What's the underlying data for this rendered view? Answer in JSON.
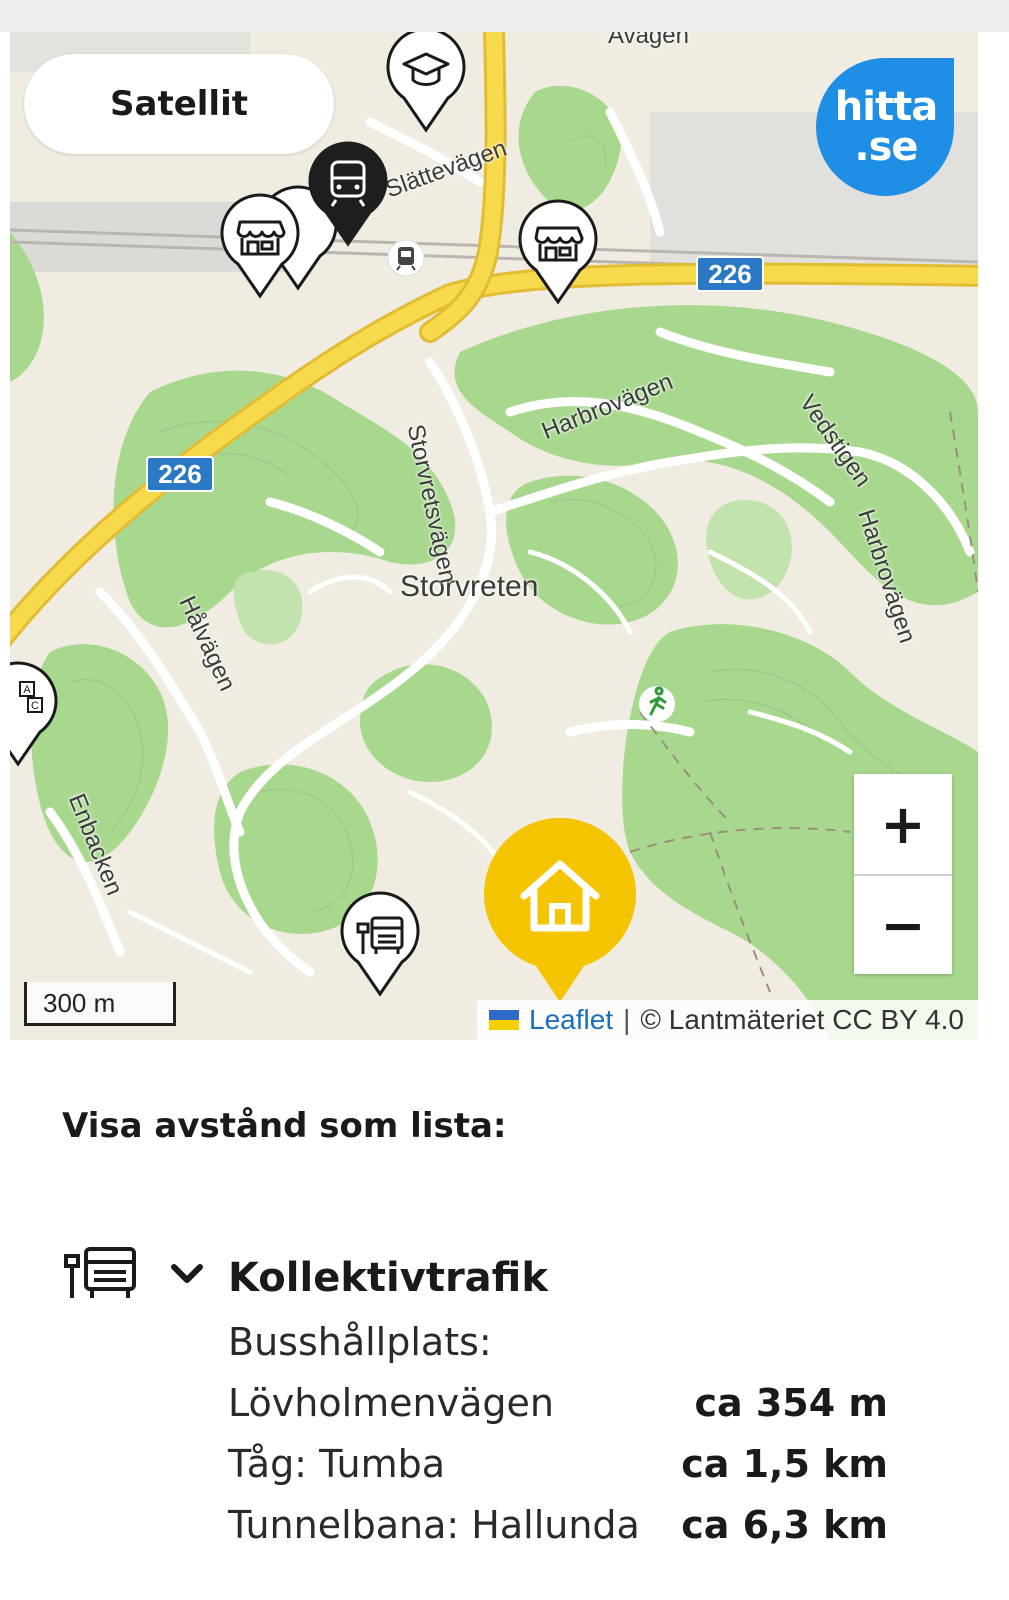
{
  "map": {
    "satellite_label": "Satellit",
    "logo": {
      "line1": "hitta",
      "line2": ".se",
      "color": "#1f8fe6"
    },
    "labels": {
      "district": "Storvreten",
      "road_226_a": "226",
      "road_226_b": "226",
      "storvretsvagen": "Storvretsvägen",
      "harbrovagen_1": "Harbrovägen",
      "harbrovagen_2": "Harbrovägen",
      "vedstigen": "Vedstigen",
      "halvagen": "Hålvägen",
      "enbacken": "Enbacken",
      "slattevagen": "Slättevägen",
      "avagen": "Avägen"
    },
    "zoom": {
      "in": "+",
      "out": "−"
    },
    "scale": "300 m",
    "attribution": {
      "link": "Leaflet",
      "separator": "|",
      "text": "© Lantmäteriet CC BY 4.0"
    },
    "markers": [
      "school-marker",
      "train-station-marker",
      "shop-marker",
      "shop-marker",
      "shop-marker",
      "bus-stop-marker",
      "home-marker",
      "preschool-marker"
    ],
    "colors": {
      "home": "#f5c400",
      "highway": "#f7d94c",
      "green": "#a8d88e",
      "road_shield": "#2b78c5"
    }
  },
  "list": {
    "heading": "Visa avstånd som lista:",
    "category": {
      "title": "Kollektivtrafik",
      "icon": "bus-stop-icon",
      "rows": [
        {
          "label": "Busshållplats:",
          "value": ""
        },
        {
          "label": "Lövholmenvägen",
          "value": "ca 354 m"
        },
        {
          "label": "Tåg: Tumba",
          "value": "ca 1,5 km"
        },
        {
          "label": "Tunnelbana: Hallunda",
          "value": "ca 6,3 km"
        }
      ]
    }
  }
}
